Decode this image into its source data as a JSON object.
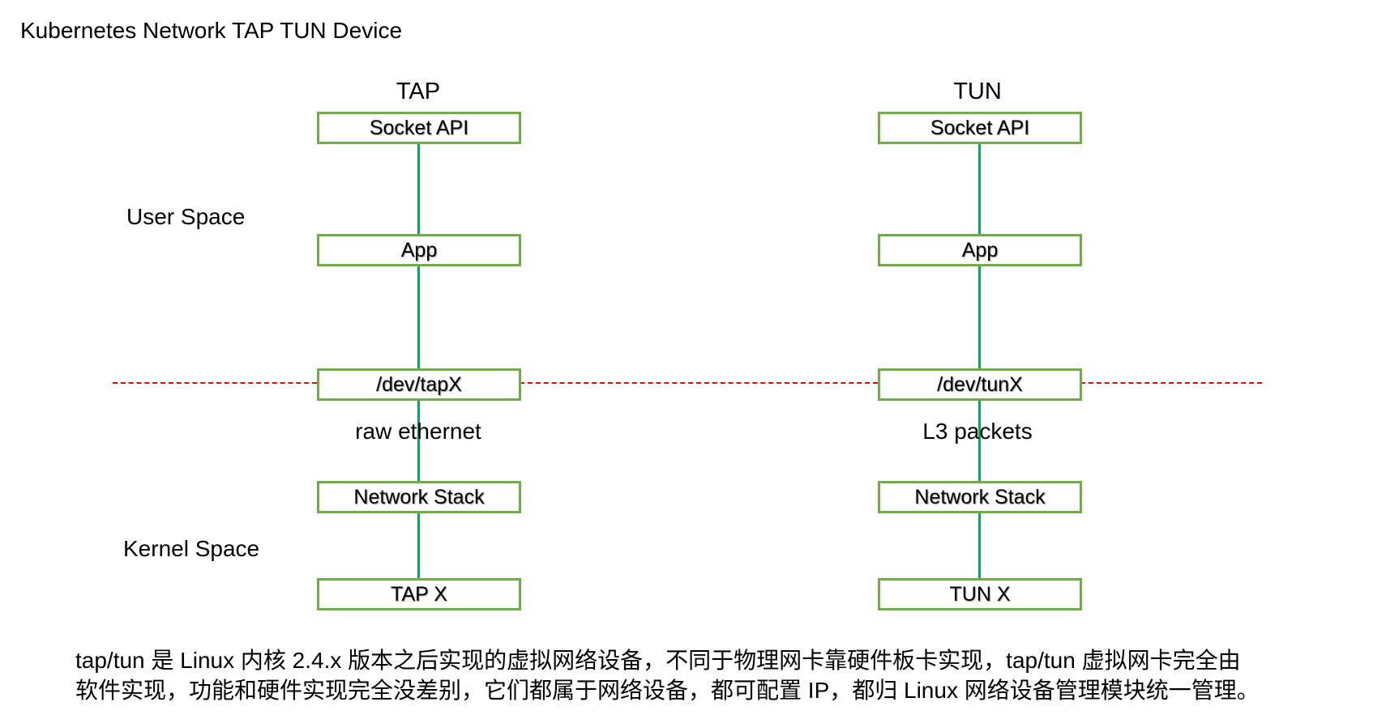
{
  "title": "Kubernetes Network TAP TUN Device",
  "regions": {
    "user_space": "User   Space",
    "kernel_space": "Kernel Space"
  },
  "tap": {
    "label": "TAP",
    "boxes": [
      "Socket API",
      "App",
      "/dev/tapX",
      "Network Stack",
      "TAP X"
    ],
    "link_label": "raw ethernet"
  },
  "tun": {
    "label": "TUN",
    "boxes": [
      "Socket API",
      "App",
      "/dev/tunX",
      "Network Stack",
      "TUN X"
    ],
    "link_label": "L3 packets"
  },
  "description": [
    "tap/tun 是 Linux 内核 2.4.x 版本之后实现的虚拟网络设备，不同于物理网卡靠硬件板卡实现，tap/tun 虚拟网卡完全由",
    "软件实现，功能和硬件实现完全没差别，它们都属于网络设备，都可配置 IP，都归 Linux 网络设备管理模块统一管理。"
  ],
  "colors": {
    "box_border": "#70ad47",
    "link": "#00b050",
    "boundary": "#ff0000"
  }
}
